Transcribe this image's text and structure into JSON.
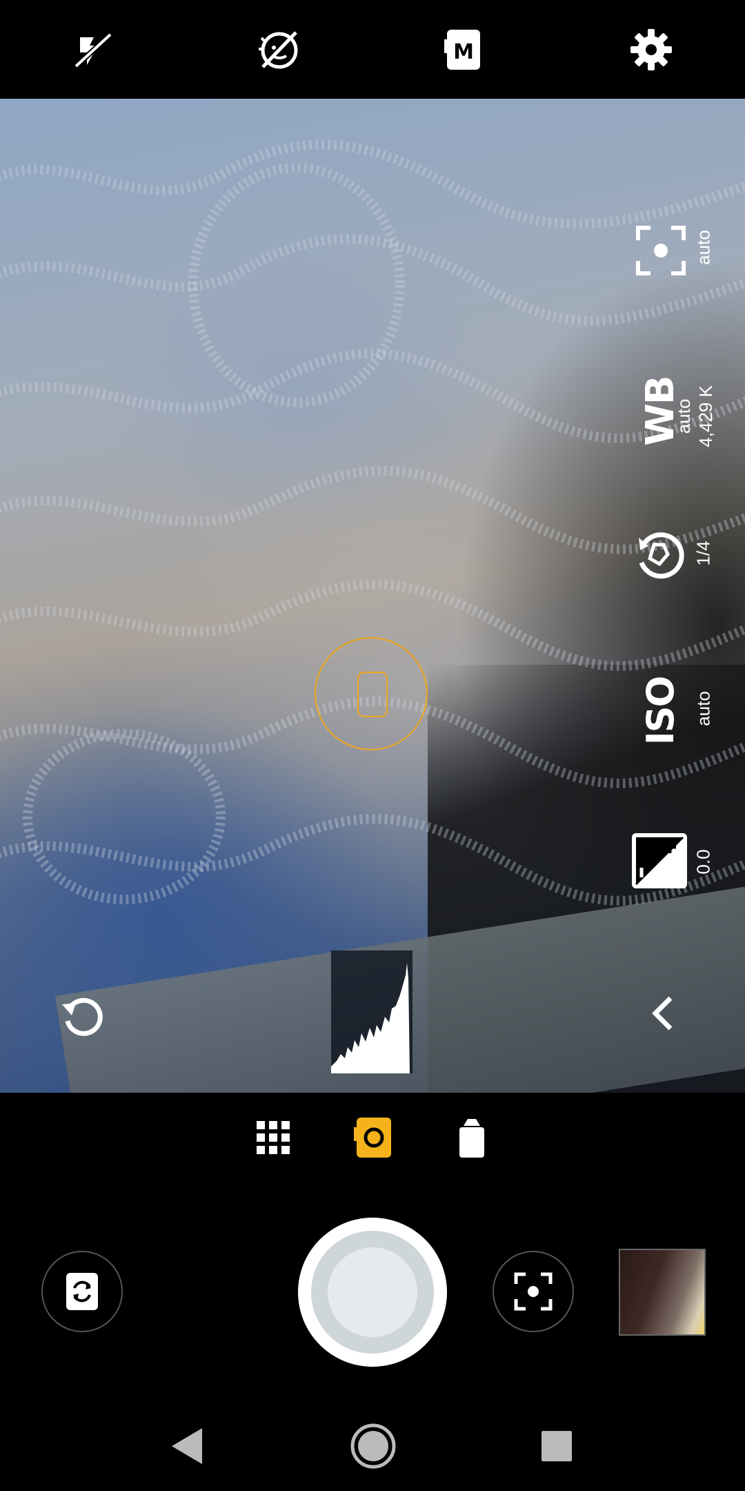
{
  "top_bar": {
    "icons": [
      "flash-off-icon",
      "face-detection-off-icon",
      "manual-mode-icon",
      "settings-gear-icon"
    ]
  },
  "manual_controls": {
    "focus": {
      "icon": "focus-icon",
      "value": "auto"
    },
    "white_balance": {
      "symbol": "WB",
      "mode": "auto",
      "kelvin": "4,429 K"
    },
    "shutter_speed": {
      "icon": "shutter-speed-icon",
      "value": "1/4"
    },
    "iso": {
      "symbol": "ISO",
      "value": "auto"
    },
    "exposure_compensation": {
      "icon": "exposure-compensation-icon",
      "value": "0.0"
    }
  },
  "viewfinder": {
    "focus_ring_color": "#f0a61a",
    "reset_icon": "reset-icon",
    "collapse_icon": "chevron-left-icon"
  },
  "mode_bar": {
    "modes": [
      "grid-icon",
      "photo-camera-icon",
      "video-camera-icon"
    ],
    "active_mode": "photo-camera-icon",
    "accent_color": "#f5b21b"
  },
  "shutter_row": {
    "switch_camera_icon": "switch-camera-icon",
    "shutter_icon": "shutter-button",
    "focus_lock_icon": "focus-icon",
    "gallery_thumbnail": "last-photo-thumbnail"
  },
  "nav_bar": {
    "icons": [
      "back-icon",
      "home-icon",
      "recents-icon"
    ]
  }
}
